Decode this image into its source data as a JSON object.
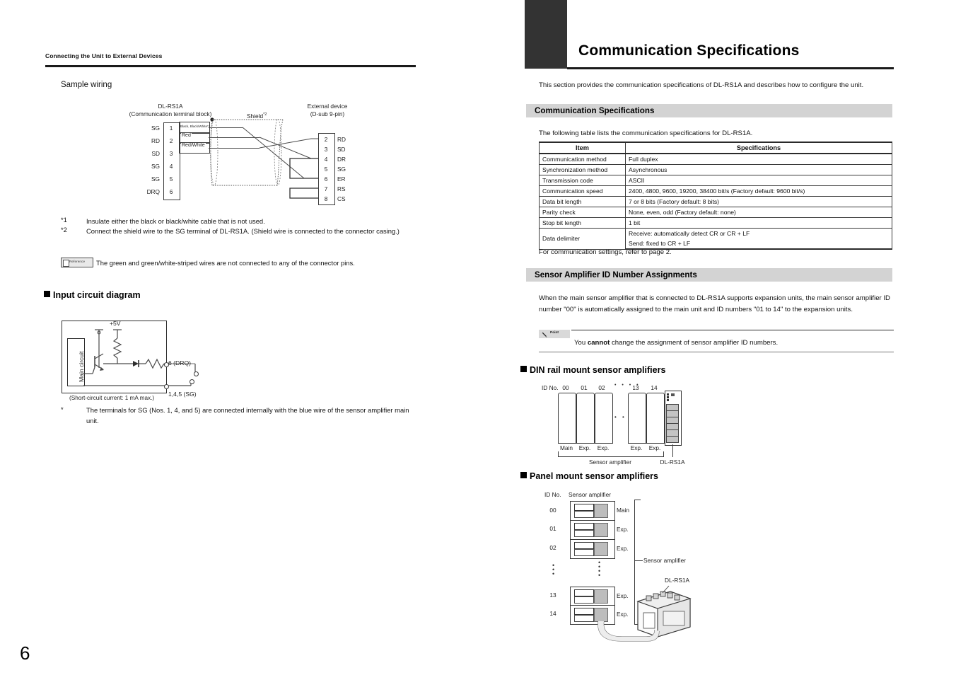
{
  "page": {
    "number": "6"
  },
  "left": {
    "running_head": "Connecting the Unit to External Devices",
    "sample_wiring_title": "Sample wiring",
    "wiring": {
      "left_device_title": "DL-RS1A",
      "left_device_sub": "(Communication terminal block)",
      "right_device_title": "External device",
      "right_device_sub": "(D-sub 9-pin)",
      "shield_label": "Shield",
      "shield_sup": "*2",
      "left_pins": [
        {
          "name": "SG",
          "no": "1"
        },
        {
          "name": "RD",
          "no": "2"
        },
        {
          "name": "SD",
          "no": "3"
        },
        {
          "name": "SG",
          "no": "4"
        },
        {
          "name": "SG",
          "no": "5"
        },
        {
          "name": "DRQ",
          "no": "6"
        }
      ],
      "wire_labels": [
        "Black, Black/White*1",
        "Red",
        "Red/White"
      ],
      "right_pins": [
        {
          "no": "2",
          "name": "RD"
        },
        {
          "no": "3",
          "name": "SD"
        },
        {
          "no": "4",
          "name": "DR"
        },
        {
          "no": "5",
          "name": "SG"
        },
        {
          "no": "6",
          "name": "ER"
        },
        {
          "no": "7",
          "name": "RS"
        },
        {
          "no": "8",
          "name": "CS"
        }
      ]
    },
    "footnotes": [
      {
        "mark": "*1",
        "text": "Insulate either the black or black/white cable that is not used."
      },
      {
        "mark": "*2",
        "text": "Connect the shield wire to the SG terminal of DL-RS1A. (Shield wire is connected to the connector casing.)"
      }
    ],
    "reference": {
      "badge": "Reference",
      "text": "The green and green/white-striped wires are not connected to any of the connector pins."
    },
    "input_circuit": {
      "heading": "Input circuit diagram",
      "main_circuit_label": "Main circuit",
      "supply_label": "+5V",
      "drq_label": "6 (DRQ)",
      "sg_label": "1,4,5 (SG)",
      "note": "(Short-circuit current: 1 mA max.)",
      "footnote_mark": "*",
      "footnote_text": "The terminals for SG (Nos. 1, 4, and 5) are connected internally with the blue wire of the sensor amplifier main unit."
    }
  },
  "right": {
    "chapter_title": "Communication Specifications",
    "intro": "This section provides the communication specifications of DL-RS1A and describes how to configure the unit.",
    "section1": {
      "heading": "Communication Specifications",
      "lead": "The following table lists the communication specifications for DL-RS1A.",
      "table": {
        "headers": [
          "Item",
          "Specifications"
        ],
        "rows": [
          {
            "item": "Communication method",
            "spec": "Full duplex"
          },
          {
            "item": "Synchronization method",
            "spec": "Asynchronous"
          },
          {
            "item": "Transmission code",
            "spec": "ASCII"
          },
          {
            "item": "Communication speed",
            "spec": "2400, 4800, 9600, 19200, 38400 bit/s (Factory default: 9600 bit/s)"
          },
          {
            "item": "Data bit length",
            "spec": "7 or 8 bits (Factory default: 8 bits)"
          },
          {
            "item": "Parity check",
            "spec": "None, even, odd (Factory default: none)"
          },
          {
            "item": "Stop bit length",
            "spec": "1 bit"
          }
        ],
        "delimiter_item": "Data delimiter",
        "delimiter_specs": [
          "Receive: automatically detect CR or CR + LF",
          "Send: fixed to CR + LF"
        ]
      },
      "after_table": "For communication settings, refer to page 2."
    },
    "section2": {
      "heading": "Sensor Amplifier ID Number Assignments",
      "paragraph": "When the main sensor amplifier that is connected to DL-RS1A supports expansion units, the main sensor amplifier ID number \"00\" is automatically assigned to the main unit and ID numbers \"01 to 14\" to the expansion units.",
      "point": {
        "badge": "Point",
        "text_before": "You ",
        "text_bold": "cannot",
        "text_after": " change the assignment of sensor amplifier ID numbers."
      }
    },
    "din_rail": {
      "heading": "DIN rail mount sensor amplifiers",
      "id_no_label": "ID No.",
      "ids": [
        "00",
        "01",
        "02",
        "13",
        "14"
      ],
      "dots": "• • • •",
      "unit_labels": [
        "Main",
        "Exp.",
        "Exp.",
        "Exp.",
        "Exp."
      ],
      "brace_label": "Sensor amplifier",
      "rs1a_label": "DL-RS1A"
    },
    "panel_mount": {
      "heading": "Panel mount sensor amplifiers",
      "id_no_label": "ID No.",
      "column_label": "Sensor amplifier",
      "rows": [
        {
          "id": "00",
          "type": "Main"
        },
        {
          "id": "01",
          "type": "Exp."
        },
        {
          "id": "02",
          "type": "Exp."
        },
        {
          "id": "13",
          "type": "Exp."
        },
        {
          "id": "14",
          "type": "Exp."
        }
      ],
      "brace_label": "Sensor amplifier",
      "rs1a_label": "DL-RS1A"
    }
  }
}
